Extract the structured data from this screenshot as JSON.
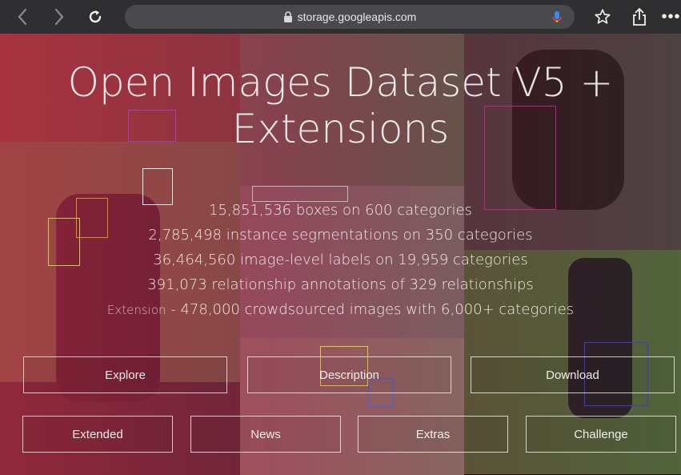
{
  "browser": {
    "url": "storage.googleapis.com",
    "icons": [
      "back-icon",
      "forward-icon",
      "reload-icon",
      "lock-icon",
      "mic-icon",
      "star-icon",
      "share-icon",
      "more-icon"
    ]
  },
  "page": {
    "title_line1": "Open Images Dataset V5 +",
    "title_line2": "Extensions",
    "stats": [
      "15,851,536 boxes on 600 categories",
      "2,785,498 instance segmentations on 350 categories",
      "36,464,560 image-level labels on 19,959 categories",
      "391,073 relationship annotations of 329 relationships"
    ],
    "extension_link": "Extension",
    "extension_text": " - 478,000 crowdsourced images with 6,000+ categories",
    "buttons_row1": [
      "Explore",
      "Description",
      "Download"
    ],
    "buttons_row2": [
      "Extended",
      "News",
      "Extras",
      "Challenge"
    ]
  },
  "colors": {
    "toolbar": "#2f2f31",
    "address_bar": "#4a4a4d",
    "overlay": "#be1e3c"
  }
}
